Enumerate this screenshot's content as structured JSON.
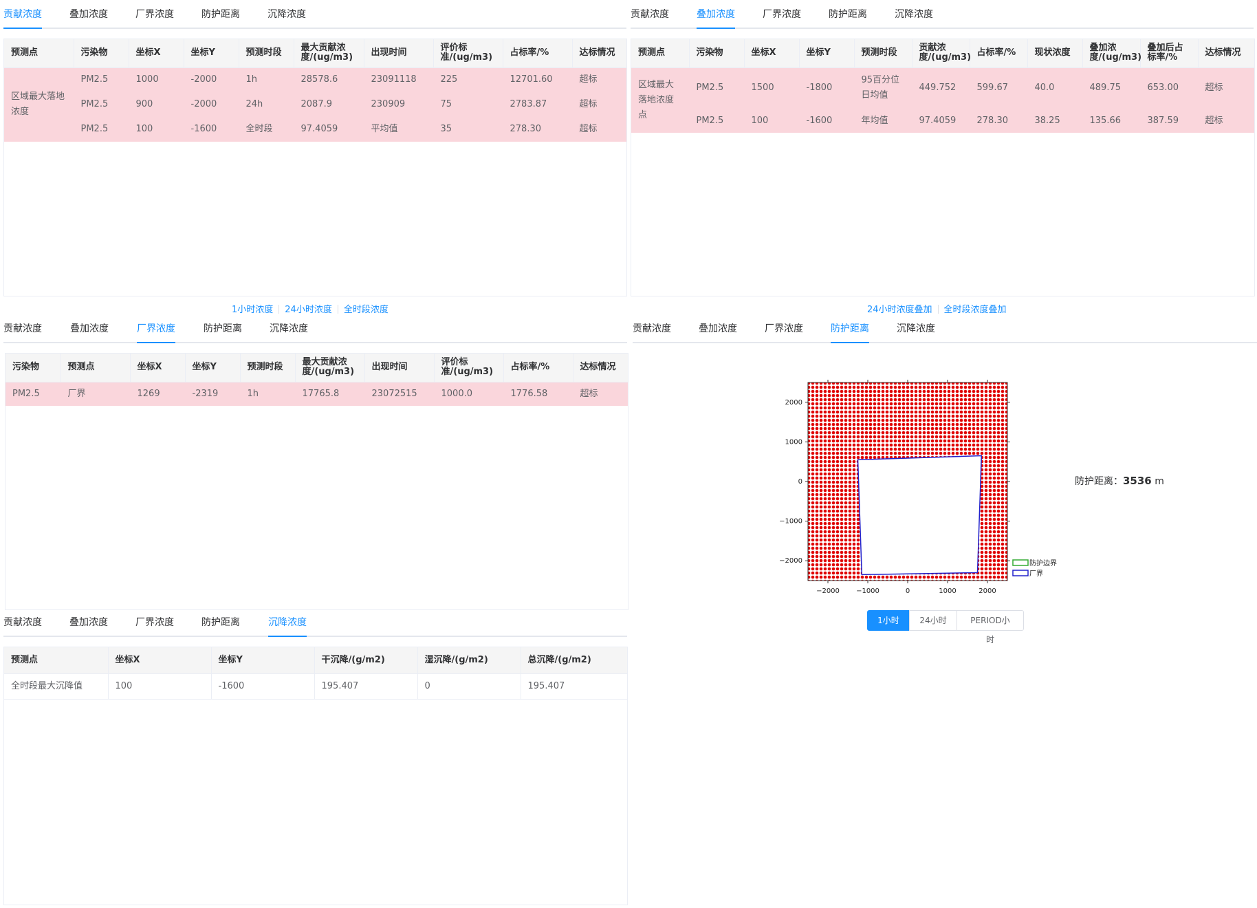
{
  "tab_labels": [
    "贡献浓度",
    "叠加浓度",
    "厂界浓度",
    "防护距离",
    "沉降浓度"
  ],
  "contribution": {
    "headers": [
      "预测点",
      "污染物",
      "坐标X",
      "坐标Y",
      "预测时段",
      "最大贡献浓度/(ug/m3)",
      "出现时间",
      "评价标准/(ug/m3)",
      "占标率/%",
      "达标情况"
    ],
    "point_label": "区域最大落地浓度",
    "rows": [
      [
        "PM2.5",
        "1000",
        "-2000",
        "1h",
        "28578.6",
        "23091118",
        "225",
        "12701.60",
        "超标"
      ],
      [
        "PM2.5",
        "900",
        "-2000",
        "24h",
        "2087.9",
        "230909",
        "75",
        "2783.87",
        "超标"
      ],
      [
        "PM2.5",
        "100",
        "-1600",
        "全时段",
        "97.4059",
        "平均值",
        "35",
        "278.30",
        "超标"
      ]
    ],
    "links": [
      "1小时浓度",
      "24小时浓度",
      "全时段浓度"
    ]
  },
  "superposition": {
    "headers": [
      "预测点",
      "污染物",
      "坐标X",
      "坐标Y",
      "预测时段",
      "贡献浓度/(ug/m3)",
      "占标率/%",
      "现状浓度",
      "叠加浓度/(ug/m3)",
      "叠加后占标率/%",
      "达标情况"
    ],
    "point_label": "区域最大落地浓度点",
    "rows": [
      [
        "PM2.5",
        "1500",
        "-1800",
        "95百分位日均值",
        "449.752",
        "599.67",
        "40.0",
        "489.75",
        "653.00",
        "超标"
      ],
      [
        "PM2.5",
        "100",
        "-1600",
        "年均值",
        "97.4059",
        "278.30",
        "38.25",
        "135.66",
        "387.59",
        "超标"
      ]
    ],
    "links": [
      "24小时浓度叠加",
      "全时段浓度叠加"
    ]
  },
  "boundary": {
    "headers": [
      "污染物",
      "预测点",
      "坐标X",
      "坐标Y",
      "预测时段",
      "最大贡献浓度/(ug/m3)",
      "出现时间",
      "评价标准/(ug/m3)",
      "占标率/%",
      "达标情况"
    ],
    "rows": [
      [
        "PM2.5",
        "厂界",
        "1269",
        "-2319",
        "1h",
        "17765.8",
        "23072515",
        "1000.0",
        "1776.58",
        "超标"
      ]
    ]
  },
  "deposition": {
    "headers": [
      "预测点",
      "坐标X",
      "坐标Y",
      "干沉降/(g/m2)",
      "湿沉降/(g/m2)",
      "总沉降/(g/m2)"
    ],
    "rows": [
      [
        "全时段最大沉降值",
        "100",
        "-1600",
        "195.407",
        "0",
        "195.407"
      ]
    ]
  },
  "protection": {
    "distance_label": "防护距离：",
    "distance_value": "3536",
    "distance_unit": "m",
    "buttons": [
      "1小时",
      "24小时",
      "PERIOD小时"
    ],
    "active_button": 0
  },
  "chart_data": {
    "type": "map",
    "x_ticks": [
      "-2000",
      "-1000",
      "0",
      "1000",
      "2000"
    ],
    "y_ticks": [
      "2000",
      "1000",
      "0",
      "-1000",
      "-2000"
    ],
    "xlim": [
      -2500,
      2500
    ],
    "ylim": [
      -2500,
      2500
    ],
    "legend": [
      "防护边界",
      "厂界"
    ],
    "legend_colors": [
      "#33aa33",
      "#2222cc"
    ],
    "dot_color": "#e00000",
    "plant_boundary": [
      [
        -1250,
        550
      ],
      [
        1850,
        650
      ],
      [
        1750,
        -2300
      ],
      [
        -1150,
        -2350
      ]
    ],
    "legend_position": "bottom-right"
  }
}
